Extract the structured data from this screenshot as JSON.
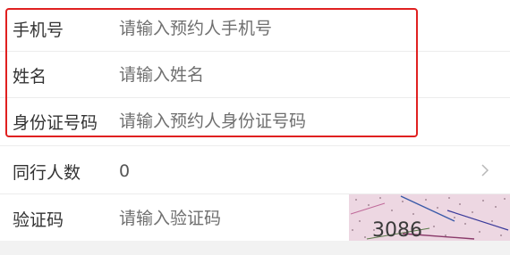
{
  "form": {
    "phone": {
      "label": "手机号",
      "placeholder": "请输入预约人手机号"
    },
    "name": {
      "label": "姓名",
      "placeholder": "请输入姓名"
    },
    "id_number": {
      "label": "身份证号码",
      "placeholder": "请输入预约人身份证号码"
    },
    "companions": {
      "label": "同行人数",
      "value": "0"
    },
    "captcha": {
      "label": "验证码",
      "placeholder": "请输入验证码",
      "image_text": "3086"
    }
  },
  "colors": {
    "highlight_border": "#e02020",
    "label_text": "#333333",
    "placeholder_text": "#6f6f6f",
    "captcha_bg": "#f1dce6"
  },
  "icons": {
    "chevron": "chevron-right-icon"
  }
}
